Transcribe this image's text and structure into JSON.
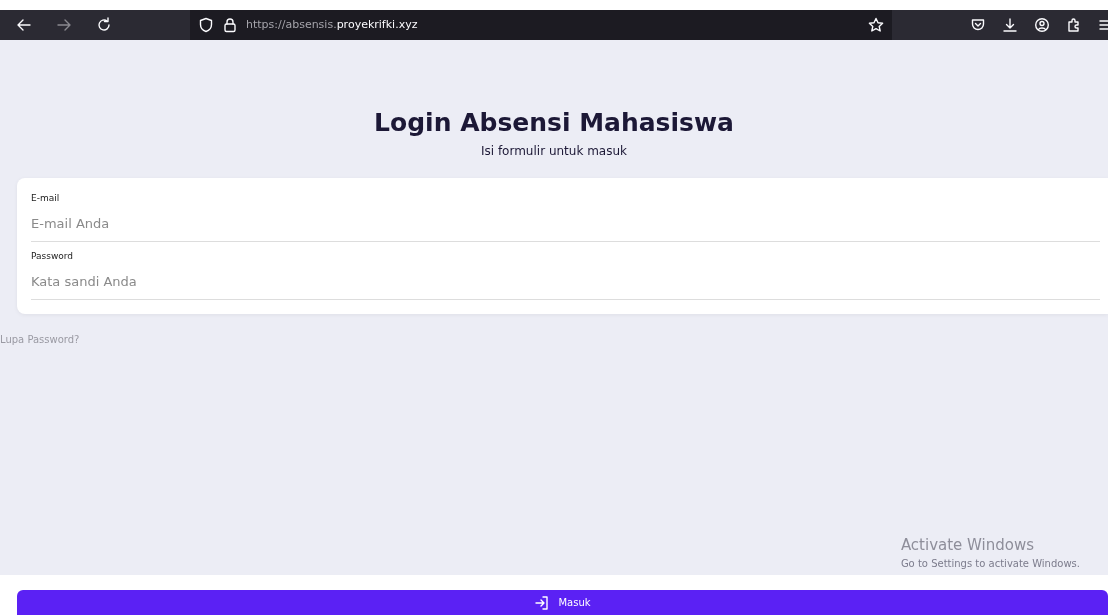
{
  "browser": {
    "url_prefix": "https://absensis.",
    "url_domain": "proyekrifki.xyz",
    "forward_disabled": true
  },
  "heading": {
    "title": "Login Absensi Mahasiswa",
    "subtitle": "Isi formulir untuk masuk"
  },
  "form": {
    "fields": [
      {
        "label": "E-mail",
        "placeholder": "E-mail Anda"
      },
      {
        "label": "Password",
        "placeholder": "Kata sandi Anda"
      }
    ]
  },
  "forgot_link": "Lupa Password?",
  "submit_button": "Masuk",
  "os_notice": {
    "title": "Activate Windows",
    "message": "Go to Settings to activate Windows."
  }
}
